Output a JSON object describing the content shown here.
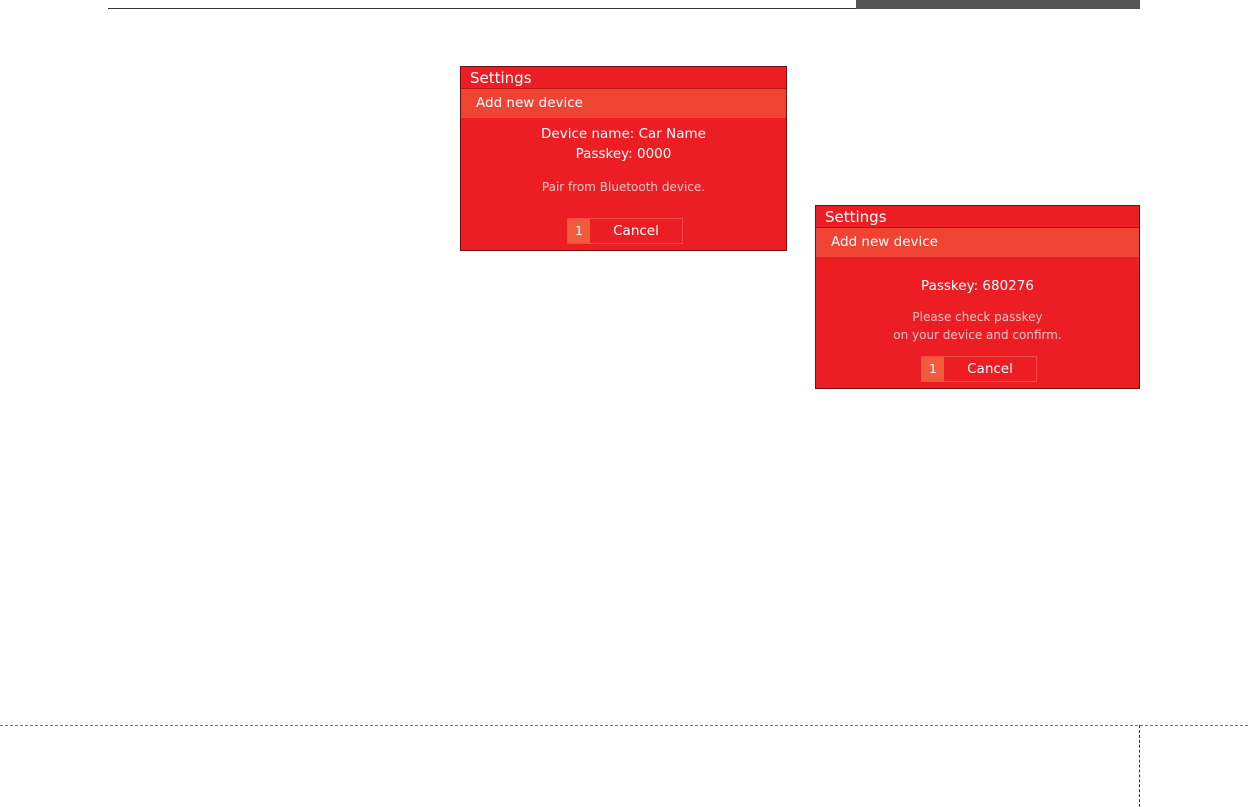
{
  "screen1": {
    "title": "Settings",
    "subtitle": "Add new device",
    "device_name_line": "Device name: Car Name",
    "passkey_line": "Passkey: 0000",
    "hint": "Pair from Bluetooth device.",
    "cancel_button": {
      "number": "1",
      "label": "Cancel"
    }
  },
  "screen2": {
    "title": "Settings",
    "subtitle": "Add new device",
    "passkey_line": "Passkey: 680276",
    "hint_line1": "Please check passkey",
    "hint_line2": "on your device and confirm.",
    "cancel_button": {
      "number": "1",
      "label": "Cancel"
    }
  },
  "colors": {
    "screen_bg": "#ec1e24",
    "subtitle_bg": "#ef4334",
    "button_number_bg": "#f15a3c"
  }
}
